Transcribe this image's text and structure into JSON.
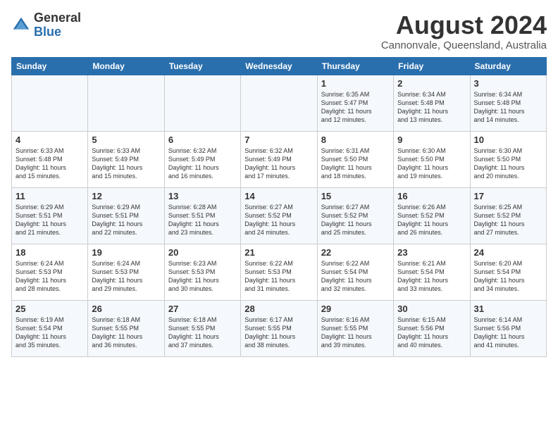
{
  "header": {
    "logo_general": "General",
    "logo_blue": "Blue",
    "month_year": "August 2024",
    "location": "Cannonvale, Queensland, Australia"
  },
  "weekdays": [
    "Sunday",
    "Monday",
    "Tuesday",
    "Wednesday",
    "Thursday",
    "Friday",
    "Saturday"
  ],
  "weeks": [
    [
      {
        "day": "",
        "info": ""
      },
      {
        "day": "",
        "info": ""
      },
      {
        "day": "",
        "info": ""
      },
      {
        "day": "",
        "info": ""
      },
      {
        "day": "1",
        "info": "Sunrise: 6:35 AM\nSunset: 5:47 PM\nDaylight: 11 hours\nand 12 minutes."
      },
      {
        "day": "2",
        "info": "Sunrise: 6:34 AM\nSunset: 5:48 PM\nDaylight: 11 hours\nand 13 minutes."
      },
      {
        "day": "3",
        "info": "Sunrise: 6:34 AM\nSunset: 5:48 PM\nDaylight: 11 hours\nand 14 minutes."
      }
    ],
    [
      {
        "day": "4",
        "info": "Sunrise: 6:33 AM\nSunset: 5:48 PM\nDaylight: 11 hours\nand 15 minutes."
      },
      {
        "day": "5",
        "info": "Sunrise: 6:33 AM\nSunset: 5:49 PM\nDaylight: 11 hours\nand 15 minutes."
      },
      {
        "day": "6",
        "info": "Sunrise: 6:32 AM\nSunset: 5:49 PM\nDaylight: 11 hours\nand 16 minutes."
      },
      {
        "day": "7",
        "info": "Sunrise: 6:32 AM\nSunset: 5:49 PM\nDaylight: 11 hours\nand 17 minutes."
      },
      {
        "day": "8",
        "info": "Sunrise: 6:31 AM\nSunset: 5:50 PM\nDaylight: 11 hours\nand 18 minutes."
      },
      {
        "day": "9",
        "info": "Sunrise: 6:30 AM\nSunset: 5:50 PM\nDaylight: 11 hours\nand 19 minutes."
      },
      {
        "day": "10",
        "info": "Sunrise: 6:30 AM\nSunset: 5:50 PM\nDaylight: 11 hours\nand 20 minutes."
      }
    ],
    [
      {
        "day": "11",
        "info": "Sunrise: 6:29 AM\nSunset: 5:51 PM\nDaylight: 11 hours\nand 21 minutes."
      },
      {
        "day": "12",
        "info": "Sunrise: 6:29 AM\nSunset: 5:51 PM\nDaylight: 11 hours\nand 22 minutes."
      },
      {
        "day": "13",
        "info": "Sunrise: 6:28 AM\nSunset: 5:51 PM\nDaylight: 11 hours\nand 23 minutes."
      },
      {
        "day": "14",
        "info": "Sunrise: 6:27 AM\nSunset: 5:52 PM\nDaylight: 11 hours\nand 24 minutes."
      },
      {
        "day": "15",
        "info": "Sunrise: 6:27 AM\nSunset: 5:52 PM\nDaylight: 11 hours\nand 25 minutes."
      },
      {
        "day": "16",
        "info": "Sunrise: 6:26 AM\nSunset: 5:52 PM\nDaylight: 11 hours\nand 26 minutes."
      },
      {
        "day": "17",
        "info": "Sunrise: 6:25 AM\nSunset: 5:52 PM\nDaylight: 11 hours\nand 27 minutes."
      }
    ],
    [
      {
        "day": "18",
        "info": "Sunrise: 6:24 AM\nSunset: 5:53 PM\nDaylight: 11 hours\nand 28 minutes."
      },
      {
        "day": "19",
        "info": "Sunrise: 6:24 AM\nSunset: 5:53 PM\nDaylight: 11 hours\nand 29 minutes."
      },
      {
        "day": "20",
        "info": "Sunrise: 6:23 AM\nSunset: 5:53 PM\nDaylight: 11 hours\nand 30 minutes."
      },
      {
        "day": "21",
        "info": "Sunrise: 6:22 AM\nSunset: 5:53 PM\nDaylight: 11 hours\nand 31 minutes."
      },
      {
        "day": "22",
        "info": "Sunrise: 6:22 AM\nSunset: 5:54 PM\nDaylight: 11 hours\nand 32 minutes."
      },
      {
        "day": "23",
        "info": "Sunrise: 6:21 AM\nSunset: 5:54 PM\nDaylight: 11 hours\nand 33 minutes."
      },
      {
        "day": "24",
        "info": "Sunrise: 6:20 AM\nSunset: 5:54 PM\nDaylight: 11 hours\nand 34 minutes."
      }
    ],
    [
      {
        "day": "25",
        "info": "Sunrise: 6:19 AM\nSunset: 5:54 PM\nDaylight: 11 hours\nand 35 minutes."
      },
      {
        "day": "26",
        "info": "Sunrise: 6:18 AM\nSunset: 5:55 PM\nDaylight: 11 hours\nand 36 minutes."
      },
      {
        "day": "27",
        "info": "Sunrise: 6:18 AM\nSunset: 5:55 PM\nDaylight: 11 hours\nand 37 minutes."
      },
      {
        "day": "28",
        "info": "Sunrise: 6:17 AM\nSunset: 5:55 PM\nDaylight: 11 hours\nand 38 minutes."
      },
      {
        "day": "29",
        "info": "Sunrise: 6:16 AM\nSunset: 5:55 PM\nDaylight: 11 hours\nand 39 minutes."
      },
      {
        "day": "30",
        "info": "Sunrise: 6:15 AM\nSunset: 5:56 PM\nDaylight: 11 hours\nand 40 minutes."
      },
      {
        "day": "31",
        "info": "Sunrise: 6:14 AM\nSunset: 5:56 PM\nDaylight: 11 hours\nand 41 minutes."
      }
    ]
  ]
}
